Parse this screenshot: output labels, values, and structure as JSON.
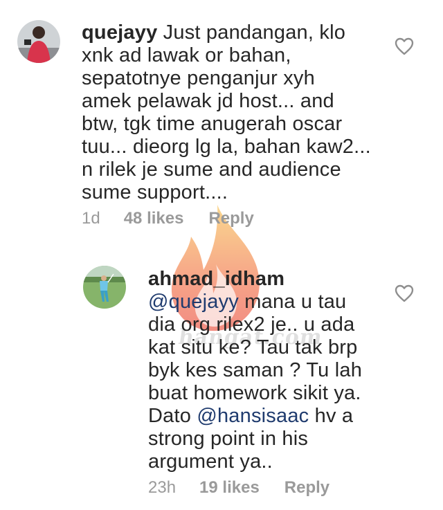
{
  "comments": [
    {
      "username": "quejayy",
      "text": " Just pandangan, klo\nxnk ad lawak or bahan,\nsepatotnye penganjur xyh\namek pelawak jd host... and\nbtw, tgk time anugerah oscar\ntuu... dieorg lg la, bahan kaw2...\nn rilek je sume and audience\nsume support....",
      "time": "1d",
      "likes": "48 likes",
      "reply": "Reply",
      "avatar_icon": "user-avatar-photo",
      "like_icon": "heart-outline-icon"
    },
    {
      "username": "ahmad_idham",
      "mention1": "@quejayy",
      "text_a": " mana u tau\ndia org rilex2 je.. u ada\nkat situ ke? Tau tak brp\nbyk kes saman ?  Tu lah\nbuat homework sikit ya.\nDato ",
      "mention2": "@hansisaac",
      "text_b": " hv a\nstrong point in his\nargument ya..",
      "time": "23h",
      "likes": "19 likes",
      "reply": "Reply",
      "avatar_icon": "golfer-avatar-photo",
      "like_icon": "heart-outline-icon"
    }
  ],
  "watermark": {
    "text": "hangat.com",
    "icon": "flame-logo",
    "colors": [
      "#f7b733",
      "#f05a28",
      "#e8301c"
    ]
  },
  "colors": {
    "text": "#262626",
    "meta": "#9a9a9a",
    "mention": "#1f3b6e"
  }
}
